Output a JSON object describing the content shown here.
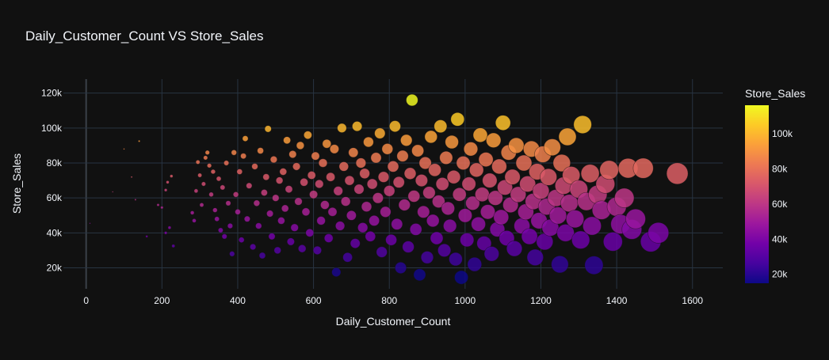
{
  "chart_data": {
    "type": "scatter",
    "title": "Daily_Customer_Count VS Store_Sales",
    "xlabel": "Daily_Customer_Count",
    "ylabel": "Store_Sales",
    "xlim": [
      -60,
      1680
    ],
    "ylim": [
      8000,
      128000
    ],
    "x_ticks": [
      0,
      200,
      400,
      600,
      800,
      1000,
      1200,
      1400,
      1600
    ],
    "y_ticks": [
      20000,
      40000,
      60000,
      80000,
      100000,
      120000
    ],
    "x_tick_labels": [
      "0",
      "200",
      "400",
      "600",
      "800",
      "1000",
      "1200",
      "1400",
      "1600"
    ],
    "y_tick_labels": [
      "20k",
      "40k",
      "60k",
      "80k",
      "100k",
      "120k"
    ],
    "grid": true,
    "colorbar": {
      "title": "Store_Sales",
      "range": [
        14920,
        116320
      ],
      "ticks": [
        20000,
        40000,
        60000,
        80000,
        100000
      ],
      "tick_labels": [
        "20k",
        "40k",
        "60k",
        "80k",
        "100k"
      ],
      "colorscale": [
        "#0d0887",
        "#46039f",
        "#7201a8",
        "#9c179e",
        "#bd3786",
        "#d8576b",
        "#ed7953",
        "#fb9f3a",
        "#fdca26",
        "#f0f921"
      ]
    },
    "marker_size_encodes": "Daily_Customer_Count",
    "points": [
      [
        10,
        45500
      ],
      [
        70,
        63500
      ],
      [
        100,
        88000
      ],
      [
        120,
        72000
      ],
      [
        130,
        59000
      ],
      [
        140,
        92500
      ],
      [
        160,
        38000
      ],
      [
        190,
        56000
      ],
      [
        200,
        54500
      ],
      [
        210,
        40000
      ],
      [
        210,
        64500
      ],
      [
        215,
        69000
      ],
      [
        220,
        43000
      ],
      [
        225,
        72500
      ],
      [
        230,
        32500
      ],
      [
        280,
        51500
      ],
      [
        285,
        47000
      ],
      [
        290,
        64000
      ],
      [
        295,
        80500
      ],
      [
        300,
        73000
      ],
      [
        305,
        56000
      ],
      [
        310,
        68000
      ],
      [
        315,
        83000
      ],
      [
        320,
        86000
      ],
      [
        325,
        78500
      ],
      [
        330,
        62000
      ],
      [
        335,
        75000
      ],
      [
        340,
        53000
      ],
      [
        345,
        48000
      ],
      [
        350,
        71000
      ],
      [
        355,
        41500
      ],
      [
        360,
        66000
      ],
      [
        365,
        38000
      ],
      [
        370,
        80000
      ],
      [
        375,
        57000
      ],
      [
        380,
        44000
      ],
      [
        385,
        28000
      ],
      [
        390,
        86000
      ],
      [
        395,
        62000
      ],
      [
        400,
        52000
      ],
      [
        405,
        75000
      ],
      [
        410,
        36000
      ],
      [
        415,
        84000
      ],
      [
        420,
        94000
      ],
      [
        425,
        48000
      ],
      [
        430,
        67000
      ],
      [
        440,
        32000
      ],
      [
        445,
        78000
      ],
      [
        450,
        57000
      ],
      [
        455,
        44000
      ],
      [
        460,
        87000
      ],
      [
        465,
        27000
      ],
      [
        470,
        63000
      ],
      [
        475,
        72000
      ],
      [
        480,
        99500
      ],
      [
        485,
        51000
      ],
      [
        490,
        38000
      ],
      [
        495,
        82000
      ],
      [
        500,
        60000
      ],
      [
        505,
        30000
      ],
      [
        510,
        70000
      ],
      [
        515,
        47000
      ],
      [
        520,
        75000
      ],
      [
        525,
        54000
      ],
      [
        530,
        93000
      ],
      [
        535,
        65000
      ],
      [
        540,
        35000
      ],
      [
        545,
        85000
      ],
      [
        550,
        43000
      ],
      [
        555,
        78000
      ],
      [
        560,
        58000
      ],
      [
        565,
        90000
      ],
      [
        570,
        31000
      ],
      [
        575,
        69000
      ],
      [
        580,
        52000
      ],
      [
        585,
        96000
      ],
      [
        590,
        40000
      ],
      [
        595,
        73000
      ],
      [
        600,
        62000
      ],
      [
        605,
        84000
      ],
      [
        610,
        30000
      ],
      [
        615,
        68000
      ],
      [
        620,
        47000
      ],
      [
        625,
        80000
      ],
      [
        630,
        56000
      ],
      [
        635,
        91000
      ],
      [
        640,
        37000
      ],
      [
        645,
        72000
      ],
      [
        650,
        52000
      ],
      [
        655,
        88000
      ],
      [
        660,
        17500
      ],
      [
        665,
        64000
      ],
      [
        670,
        44000
      ],
      [
        675,
        100000
      ],
      [
        680,
        78000
      ],
      [
        685,
        58000
      ],
      [
        690,
        26000
      ],
      [
        695,
        70000
      ],
      [
        700,
        50000
      ],
      [
        705,
        86000
      ],
      [
        710,
        34000
      ],
      [
        715,
        101000
      ],
      [
        720,
        65000
      ],
      [
        725,
        80000
      ],
      [
        730,
        43000
      ],
      [
        735,
        74000
      ],
      [
        740,
        55000
      ],
      [
        745,
        92000
      ],
      [
        750,
        38000
      ],
      [
        755,
        68000
      ],
      [
        760,
        47000
      ],
      [
        765,
        83000
      ],
      [
        770,
        60000
      ],
      [
        775,
        97000
      ],
      [
        780,
        29000
      ],
      [
        785,
        72000
      ],
      [
        790,
        52000
      ],
      [
        795,
        88000
      ],
      [
        800,
        64000
      ],
      [
        805,
        36000
      ],
      [
        810,
        78000
      ],
      [
        815,
        101000
      ],
      [
        820,
        45000
      ],
      [
        825,
        69000
      ],
      [
        830,
        20000
      ],
      [
        835,
        84000
      ],
      [
        840,
        56000
      ],
      [
        845,
        93000
      ],
      [
        850,
        32000
      ],
      [
        855,
        74000
      ],
      [
        860,
        116000
      ],
      [
        865,
        61000
      ],
      [
        870,
        42000
      ],
      [
        875,
        87000
      ],
      [
        880,
        16000
      ],
      [
        885,
        70000
      ],
      [
        890,
        52000
      ],
      [
        895,
        80000
      ],
      [
        900,
        26000
      ],
      [
        905,
        63000
      ],
      [
        910,
        95000
      ],
      [
        915,
        47000
      ],
      [
        920,
        76000
      ],
      [
        925,
        37000
      ],
      [
        930,
        58000
      ],
      [
        935,
        101000
      ],
      [
        940,
        68000
      ],
      [
        945,
        30000
      ],
      [
        950,
        83000
      ],
      [
        955,
        54000
      ],
      [
        960,
        44000
      ],
      [
        965,
        92000
      ],
      [
        970,
        72000
      ],
      [
        975,
        25000
      ],
      [
        980,
        105000
      ],
      [
        985,
        62000
      ],
      [
        990,
        14500
      ],
      [
        995,
        80000
      ],
      [
        1000,
        50000
      ],
      [
        1005,
        36000
      ],
      [
        1010,
        68000
      ],
      [
        1015,
        88000
      ],
      [
        1020,
        57000
      ],
      [
        1025,
        22000
      ],
      [
        1030,
        76000
      ],
      [
        1035,
        45000
      ],
      [
        1040,
        96000
      ],
      [
        1045,
        62000
      ],
      [
        1050,
        34000
      ],
      [
        1055,
        82000
      ],
      [
        1060,
        52000
      ],
      [
        1065,
        70000
      ],
      [
        1070,
        28000
      ],
      [
        1075,
        93000
      ],
      [
        1080,
        60000
      ],
      [
        1085,
        42000
      ],
      [
        1090,
        78000
      ],
      [
        1095,
        49000
      ],
      [
        1100,
        103000
      ],
      [
        1105,
        66000
      ],
      [
        1110,
        37000
      ],
      [
        1115,
        86000
      ],
      [
        1120,
        56000
      ],
      [
        1125,
        72000
      ],
      [
        1130,
        31000
      ],
      [
        1135,
        90000
      ],
      [
        1140,
        62000
      ],
      [
        1150,
        44000
      ],
      [
        1155,
        80000
      ],
      [
        1160,
        52000
      ],
      [
        1165,
        68000
      ],
      [
        1170,
        38000
      ],
      [
        1175,
        88000
      ],
      [
        1180,
        58000
      ],
      [
        1185,
        26000
      ],
      [
        1190,
        75000
      ],
      [
        1195,
        47000
      ],
      [
        1200,
        64000
      ],
      [
        1205,
        85000
      ],
      [
        1210,
        35000
      ],
      [
        1215,
        55000
      ],
      [
        1220,
        72000
      ],
      [
        1225,
        43000
      ],
      [
        1230,
        89000
      ],
      [
        1240,
        60000
      ],
      [
        1245,
        50000
      ],
      [
        1250,
        22000
      ],
      [
        1255,
        80000
      ],
      [
        1260,
        67000
      ],
      [
        1265,
        40000
      ],
      [
        1270,
        95000
      ],
      [
        1275,
        57000
      ],
      [
        1280,
        73000
      ],
      [
        1290,
        48000
      ],
      [
        1300,
        65000
      ],
      [
        1305,
        36000
      ],
      [
        1310,
        102000
      ],
      [
        1320,
        58000
      ],
      [
        1330,
        74000
      ],
      [
        1335,
        44000
      ],
      [
        1340,
        21500
      ],
      [
        1350,
        62000
      ],
      [
        1360,
        53000
      ],
      [
        1370,
        68000
      ],
      [
        1380,
        76000
      ],
      [
        1390,
        35000
      ],
      [
        1400,
        55000
      ],
      [
        1410,
        45000
      ],
      [
        1420,
        60000
      ],
      [
        1430,
        77000
      ],
      [
        1440,
        42000
      ],
      [
        1450,
        48000
      ],
      [
        1470,
        77000
      ],
      [
        1490,
        35000
      ],
      [
        1510,
        40000
      ],
      [
        1560,
        74000
      ]
    ]
  }
}
